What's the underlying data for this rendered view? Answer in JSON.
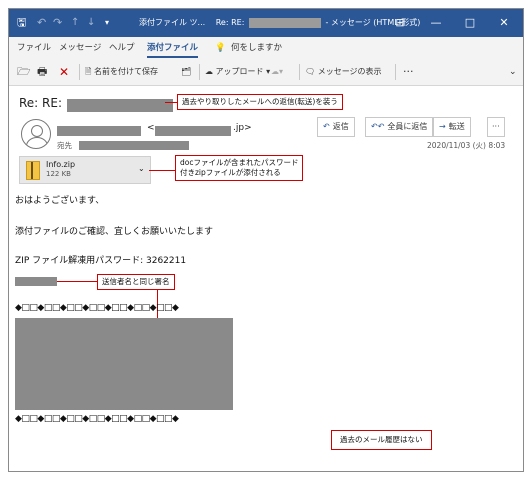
{
  "titlebar": {
    "title_prefix": "添付ファイル ツ...",
    "title_mid": "Re: RE:",
    "title_suffix": "- メッセージ (HTML 形式)",
    "icons": [
      "save-icon",
      "undo-icon",
      "redo-icon",
      "up-icon",
      "down-icon",
      "dropdown-icon"
    ],
    "controls": {
      "ribbon": "⊞",
      "minimize": "—",
      "maximize": "□",
      "close": "✕"
    }
  },
  "menu": {
    "items": [
      "ファイル",
      "メッセージ",
      "ヘルプ",
      "添付ファイル"
    ],
    "active": "添付ファイル",
    "search_hint": "何をしますか"
  },
  "toolbar": {
    "save_as": "名前を付けて保存",
    "upload": "アップロード",
    "show_message": "メッセージの表示",
    "more": "···"
  },
  "message": {
    "subject_prefix": "Re: RE:",
    "sender_domain": ".jp>",
    "sender_lt": "<",
    "to_label": "宛先",
    "date": "2020/11/03 (火) 8:03",
    "actions": {
      "reply": "返信",
      "reply_all": "全員に返信",
      "forward": "転送",
      "more": "···"
    },
    "attachment": {
      "name": "Info.zip",
      "size": "122 KB"
    },
    "body": {
      "greeting": "おはようございます、",
      "line2": "添付ファイルのご確認、宜しくお願いいたします",
      "password": "ZIP ファイル解凍用パスワード: 3262211",
      "divider": "◆□□◆□□◆□□◆□□◆□□◆□□◆□□◆"
    }
  },
  "annotations": {
    "reply_fake": "過去やり取りしたメールへの返信(転送)を装う",
    "attachment_note_1": "docファイルが含まれたパスワード",
    "attachment_note_2": "付きzipファイルが添付される",
    "signature_note": "送信者名と同じ署名",
    "no_history": "過去のメール履歴はない"
  },
  "colors": {
    "titlebar": "#2b5797",
    "accent": "#2b5797",
    "annotation": "#d00000",
    "redacted": "#8a8a8a"
  }
}
